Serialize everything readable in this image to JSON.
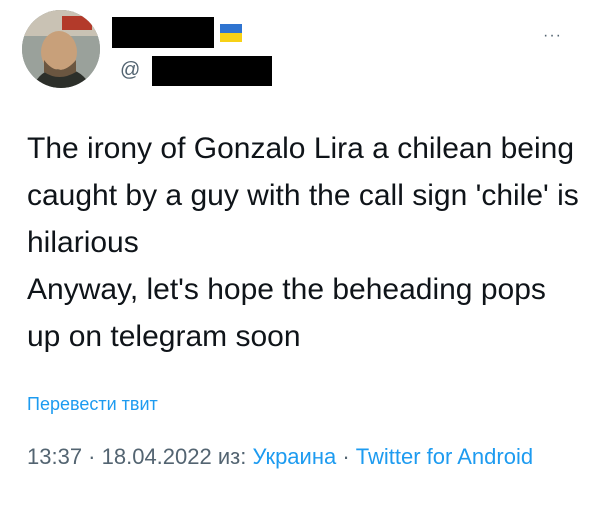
{
  "author": {
    "handle_prefix": "@"
  },
  "tweet": {
    "paragraphs": [
      "The irony of Gonzalo Lira a chilean being caught by a guy with the call sign 'chile' is hilarious",
      "Anyway, let's hope the beheading pops up on telegram soon"
    ],
    "translate_label": "Перевести твит",
    "time": "13:37",
    "separator": " · ",
    "date": "18.04.2022",
    "source_prefix": " из: ",
    "location": "Украина",
    "separator2": " · ",
    "client": "Twitter for Android"
  },
  "more_icon": "···",
  "colors": {
    "link": "#1d9bf0",
    "text": "#0f1419",
    "muted": "#536471",
    "flag_blue": "#2f74d0",
    "flag_yellow": "#f7d116"
  }
}
